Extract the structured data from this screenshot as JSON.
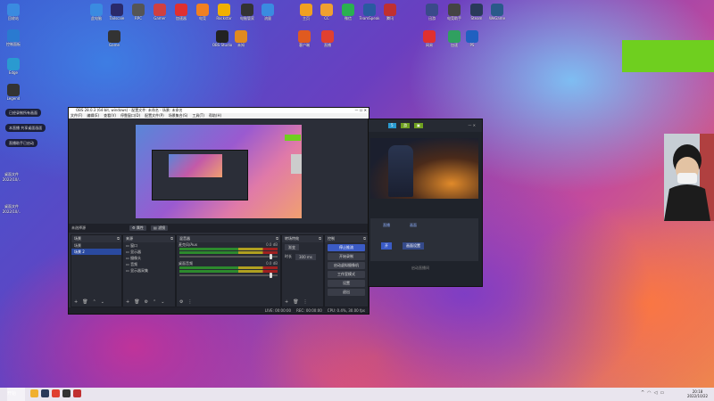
{
  "desktop": {
    "icons_top": [
      {
        "label": "此电脑",
        "icon": "computer-icon",
        "color": "#3a8be0"
      },
      {
        "label": "Tailscale",
        "icon": "tailscale-icon",
        "color": "#2a2a6a"
      },
      {
        "label": "RPC",
        "icon": "rpc-icon",
        "color": "#555"
      },
      {
        "label": "Gamer",
        "icon": "gamer-icon",
        "color": "#d04040"
      },
      {
        "label": "加速器",
        "icon": "booster-icon",
        "color": "#e03030"
      },
      {
        "label": "电竞",
        "icon": "esports-icon",
        "color": "#f08020"
      },
      {
        "label": "Rockstar",
        "icon": "rockstar-icon",
        "color": "#f0b000"
      },
      {
        "label": "电脑管家",
        "icon": "security-icon",
        "color": "#333"
      },
      {
        "label": "流量",
        "icon": "speed-icon",
        "color": "#3a8be0"
      },
      {
        "label": "主页",
        "icon": "home-icon",
        "color": "#f0a020"
      },
      {
        "label": "CC",
        "icon": "cc-icon",
        "color": "#f0a030"
      },
      {
        "label": "微信",
        "icon": "wechat-icon",
        "color": "#2ab050"
      },
      {
        "label": "TeamSpeak",
        "icon": "teamspeak-icon",
        "color": "#2a5aa0"
      },
      {
        "label": "腾讯",
        "icon": "tencent-icon",
        "color": "#c03030"
      },
      {
        "label": "迅游",
        "icon": "xunyou-icon",
        "color": "#3a4a8a"
      },
      {
        "label": "电竞助手",
        "icon": "assist-icon",
        "color": "#444"
      },
      {
        "label": "Steam",
        "icon": "steam-icon",
        "color": "#2a3a5a"
      },
      {
        "label": "WeGame",
        "icon": "wegame-icon",
        "color": "#2a5a8a"
      }
    ],
    "icons_row2": [
      {
        "label": "Game",
        "icon": "gamepad-icon",
        "color": "#333"
      },
      {
        "label": "OBS Studio",
        "icon": "obs-icon",
        "color": "#222"
      },
      {
        "label": "未知",
        "icon": "question-icon",
        "color": "#e08a20"
      },
      {
        "label": "客户端",
        "icon": "client-icon",
        "color": "#e05a20"
      },
      {
        "label": "直播",
        "icon": "live-icon",
        "color": "#e04030"
      },
      {
        "label": "网易",
        "icon": "netease-icon",
        "color": "#e03030"
      },
      {
        "label": "加速",
        "icon": "accelerator-icon",
        "color": "#30a060"
      },
      {
        "label": "PS",
        "icon": "playstation-icon",
        "color": "#2060c0"
      }
    ],
    "left_icons": [
      {
        "label": "回收站",
        "icon": "recycle-bin-icon",
        "color": "#3a8be0"
      },
      {
        "label": "控制面板",
        "icon": "control-panel-icon",
        "color": "#2a7ad0"
      },
      {
        "label": "Edge",
        "icon": "edge-icon",
        "color": "#2a9ad0"
      },
      {
        "label": "Legend",
        "icon": "legend-icon",
        "color": "#333"
      }
    ],
    "left_labels": [
      "桌面文件",
      "2022/10/..",
      "桌面文件",
      "2022/10/.."
    ],
    "notifications": [
      "已经录制所有画面",
      "本直播 共享桌面画面",
      "直播助手已启动"
    ]
  },
  "obs": {
    "title": "OBS 28.0.3 (64-bit, windows) - 配置文件: 未命名 - 场景: 未命名",
    "menu": [
      "文件(F)",
      "编辑(E)",
      "查看(V)",
      "停靠窗口(D)",
      "配置文件(P)",
      "场景集合(S)",
      "工具(T)",
      "帮助(H)"
    ],
    "scene_label": "未选择源",
    "properties_btn": "属性",
    "filters_btn": "滤镜",
    "docks": {
      "scenes": {
        "title": "场景",
        "items": [
          "场景",
          "场景 2"
        ]
      },
      "sources": {
        "title": "来源",
        "items": [
          "窗口",
          "显示器",
          "摄像头",
          "音频",
          "显示器采集"
        ]
      },
      "mixer": {
        "title": "混音器",
        "channels": [
          {
            "name": "麦克风/Aux",
            "db": "0.0 dB"
          },
          {
            "name": "桌面音频",
            "db": "0.0 dB"
          }
        ]
      },
      "transitions": {
        "title": "转场特效",
        "type": "渐变",
        "duration_label": "时长",
        "duration": "300 ms"
      },
      "controls": {
        "title": "控制",
        "buttons": [
          "停止推流",
          "开始录制",
          "启动虚拟摄像机",
          "工作室模式",
          "设置",
          "退出"
        ]
      }
    },
    "status": {
      "live": "LIVE: 00:00:00",
      "rec": "REC: 00:00:00",
      "cpu": "CPU: 0.4%, 30.00 fps"
    }
  },
  "app2": {
    "tag1": "5",
    "tag2": "游",
    "tab1": "直播",
    "tab2": "画面",
    "btn1": "开",
    "btn2": "画面设置",
    "footer": "启动直播间"
  },
  "taskbar": {
    "start": "开始",
    "apps": [
      {
        "icon": "folder-icon",
        "color": "#f0b030"
      },
      {
        "icon": "steam-icon",
        "color": "#2a3a5a"
      },
      {
        "icon": "chrome-icon",
        "color": "#e04030"
      },
      {
        "icon": "obs-icon",
        "color": "#333"
      },
      {
        "icon": "game-icon",
        "color": "#c03030"
      }
    ],
    "time": "20:18",
    "date": "2022/10/22"
  },
  "colors": {
    "accent": "#3b5bc5",
    "green": "#6fcf1f"
  }
}
